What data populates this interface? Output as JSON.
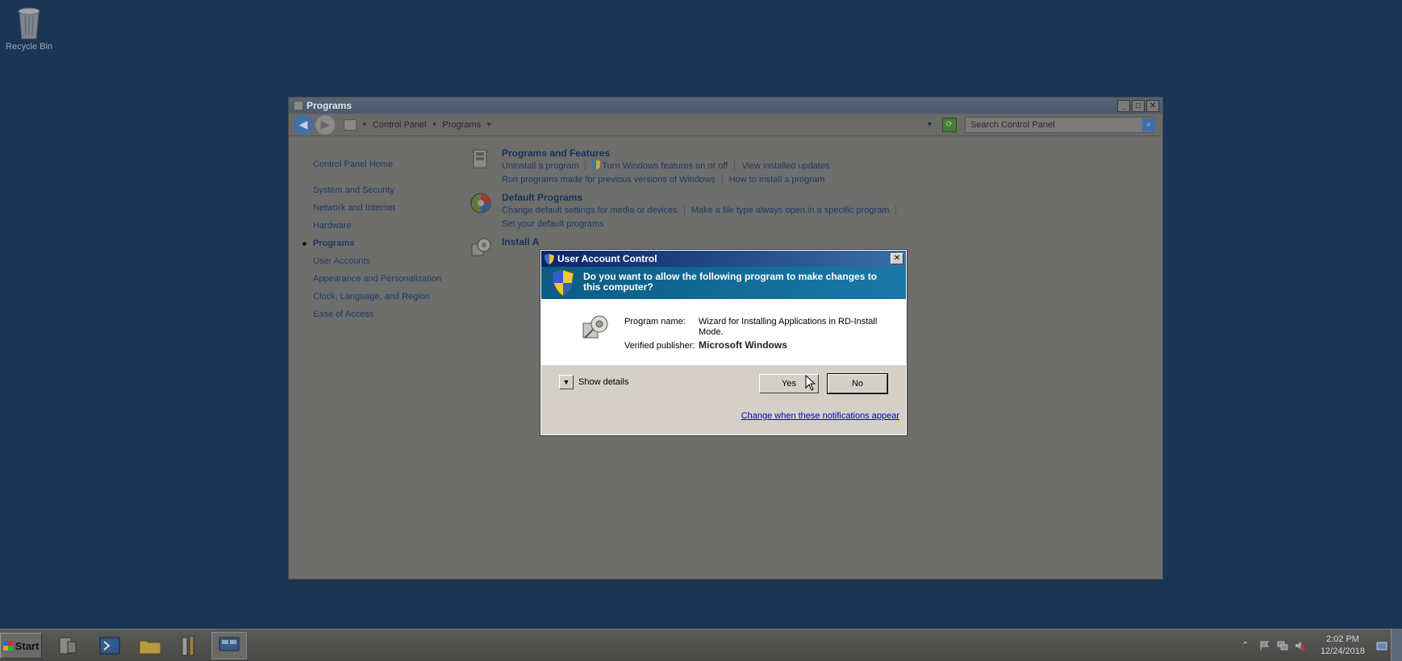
{
  "desktop": {
    "recycle_bin_label": "Recycle Bin"
  },
  "window": {
    "title": "Programs",
    "controls": {
      "minimize": "_",
      "maximize": "□",
      "close": "✕"
    },
    "breadcrumb": [
      "Control Panel",
      "Programs"
    ],
    "search_placeholder": "Search Control Panel"
  },
  "sidebar": {
    "items": [
      "Control Panel Home",
      "System and Security",
      "Network and Internet",
      "Hardware",
      "Programs",
      "User Accounts",
      "Appearance and Personalization",
      "Clock, Language, and Region",
      "Ease of Access"
    ],
    "active_index": 4
  },
  "categories": [
    {
      "title": "Programs and Features",
      "links_row1": [
        "Uninstall a program",
        "Turn Windows features on or off",
        "View installed updates"
      ],
      "links_row2": [
        "Run programs made for previous versions of Windows",
        "How to install a program"
      ]
    },
    {
      "title": "Default Programs",
      "links_row1": [
        "Change default settings for media or devices",
        "Make a file type always open in a specific program"
      ],
      "links_row2": [
        "Set your default programs"
      ]
    },
    {
      "title": "Install A"
    }
  ],
  "uac": {
    "title": "User Account Control",
    "question": "Do you want to allow the following program to make changes to this computer?",
    "program_name_label": "Program name:",
    "program_name": "Wizard for Installing Applications in RD-Install Mode.",
    "publisher_label": "Verified publisher:",
    "publisher": "Microsoft Windows",
    "show_details": "Show details",
    "yes": "Yes",
    "no": "No",
    "notifications_link": "Change when these notifications appear",
    "close": "✕"
  },
  "taskbar": {
    "start_label": "Start",
    "clock_time": "2:02 PM",
    "clock_date": "12/24/2018"
  },
  "colors": {
    "desktop": "#1b3554",
    "uac_title": "#0a246a",
    "uac_banner": "#0a5c82",
    "link": "#0000c8"
  }
}
